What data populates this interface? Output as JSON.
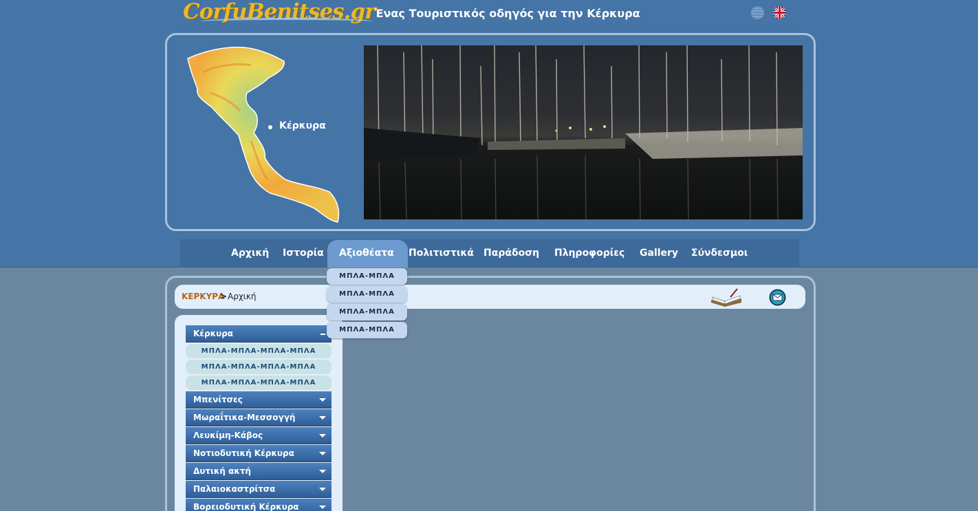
{
  "header": {
    "logo_text": "CorfuBenitses.gr",
    "tagline": "Ένας Τουριστικός οδηγός για την Κέρκυρα",
    "languages": [
      "greek-flag",
      "english-flag"
    ]
  },
  "banner": {
    "map_label": "Κέρκυρα"
  },
  "menu": {
    "items": [
      "Αρχική",
      "Ιστορία",
      "Αξιοθέατα",
      "Πολιτιστικά",
      "Παράδοση",
      "Πληροφορίες",
      "Gallery",
      "Σύνδεσμοι"
    ],
    "active": "Αξιοθέατα",
    "dropdown": [
      "ΜΠΛΑ-ΜΠΛΑ",
      "ΜΠΛΑ-ΜΠΛΑ",
      "ΜΠΛΑ-ΜΠΛΑ",
      "ΜΠΛΑ-ΜΠΛΑ"
    ]
  },
  "breadcrumb": {
    "root": "ΚΕΡΚΥΡΑ",
    "separator": ">",
    "current": "Αρχική"
  },
  "sidebar": {
    "expanded": {
      "label": "Κέρκυρα",
      "subitems": [
        "ΜΠΛΑ-ΜΠΛΑ-ΜΠΛΑ-ΜΠΛΑ",
        "ΜΠΛΑ-ΜΠΛΑ-ΜΠΛΑ-ΜΠΛΑ",
        "ΜΠΛΑ-ΜΠΛΑ-ΜΠΛΑ-ΜΠΛΑ"
      ]
    },
    "items": [
      "Μπενίτσες",
      "Μωραΐτικα-Μεσσογγή",
      "Λευκίμη-Κάβος",
      "Νοτιοδυτική Κέρκυρα",
      "Δυτική ακτή",
      "Παλαιοκαστρίτσα",
      "Βορειοδυτική Κέρκυρα"
    ]
  },
  "colors": {
    "top_band": "#4574a6",
    "page_bg": "#6b87a0",
    "breadcrumb_root": "#b4661a"
  }
}
